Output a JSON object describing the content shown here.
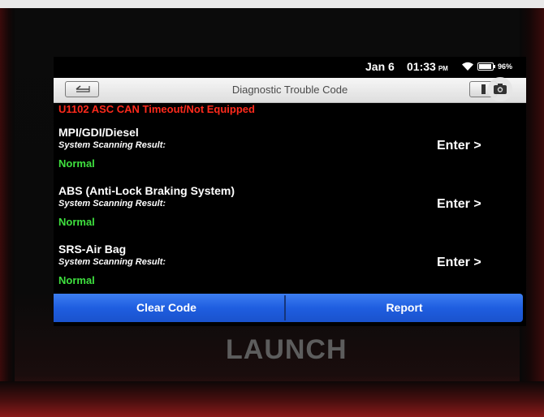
{
  "status_bar": {
    "date": "Jan 6",
    "time": "01:33",
    "ampm": "PM",
    "battery": "96%",
    "battery_level": 0.96
  },
  "header": {
    "title": "Diagnostic Trouble Code"
  },
  "dtc_message": "U1102 ASC CAN Timeout/Not Equipped",
  "systems": [
    {
      "name": "MPI/GDI/Diesel",
      "label": "System Scanning Result:",
      "result": "Normal",
      "action": "Enter >"
    },
    {
      "name": "ABS (Anti-Lock Braking System)",
      "label": "System Scanning Result:",
      "result": "Normal",
      "action": "Enter >"
    },
    {
      "name": "SRS-Air Bag",
      "label": "System Scanning Result:",
      "result": "Normal",
      "action": "Enter >"
    }
  ],
  "buttons": {
    "clear_code": "Clear Code",
    "report": "Report"
  },
  "device": {
    "brand": "LAUNCH"
  },
  "colors": {
    "error": "#ff2a1c",
    "normal": "#3fe03f",
    "button_bar": "#2a6be8"
  }
}
